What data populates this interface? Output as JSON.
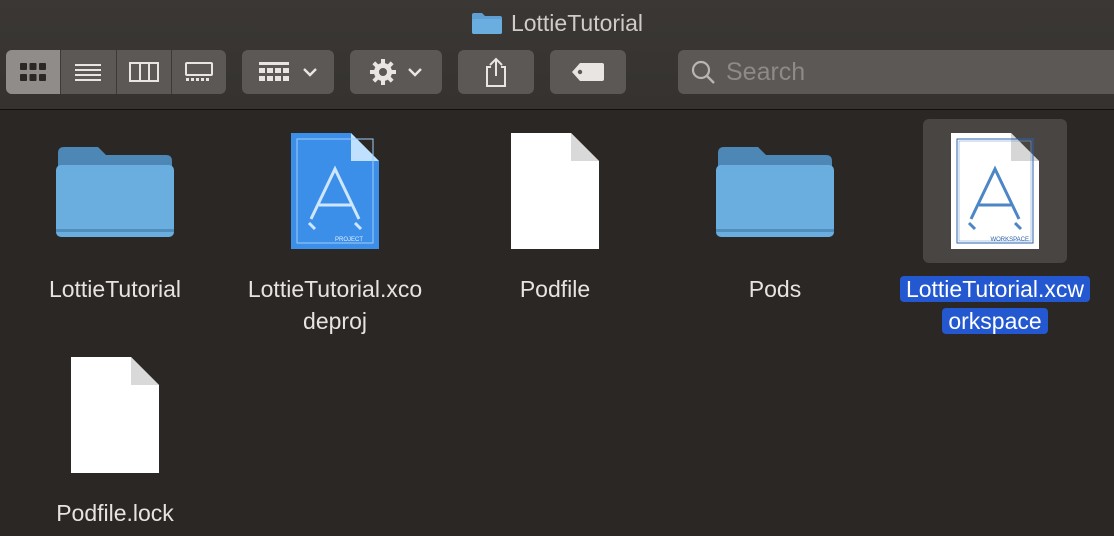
{
  "window": {
    "title": "LottieTutorial"
  },
  "toolbar": {
    "view_modes": [
      "icon-view",
      "list-view",
      "column-view",
      "gallery-view"
    ],
    "active_view": "icon-view",
    "search": {
      "placeholder": "Search",
      "value": ""
    }
  },
  "items": [
    {
      "name_line1": "LottieTutorial",
      "name_line2": "",
      "kind": "folder-icon",
      "selected": false
    },
    {
      "name_line1": "LottieTutorial.xco",
      "name_line2": "deproj",
      "kind": "xcodeproj-icon",
      "badge": "PROJECT",
      "selected": false
    },
    {
      "name_line1": "Podfile",
      "name_line2": "",
      "kind": "document-icon",
      "selected": false
    },
    {
      "name_line1": "Pods",
      "name_line2": "",
      "kind": "folder-icon",
      "selected": false
    },
    {
      "name_line1": "LottieTutorial.xcw",
      "name_line2": "orkspace",
      "kind": "xcworkspace-icon",
      "badge": "WORKSPACE",
      "selected": true
    },
    {
      "name_line1": "Podfile.lock",
      "name_line2": "",
      "kind": "document-icon",
      "selected": false
    }
  ],
  "colors": {
    "selection": "#2358d1",
    "folder": "#5f9fd3",
    "background": "#2b2724"
  }
}
